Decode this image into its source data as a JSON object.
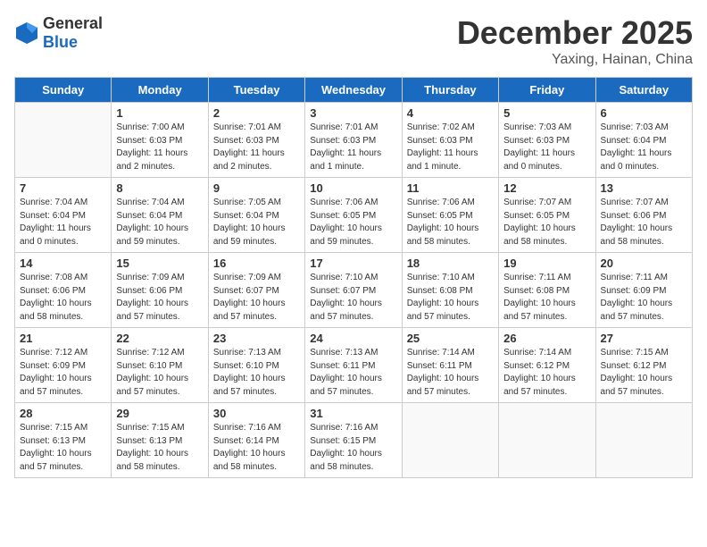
{
  "header": {
    "logo_general": "General",
    "logo_blue": "Blue",
    "month": "December 2025",
    "location": "Yaxing, Hainan, China"
  },
  "days_of_week": [
    "Sunday",
    "Monday",
    "Tuesday",
    "Wednesday",
    "Thursday",
    "Friday",
    "Saturday"
  ],
  "weeks": [
    [
      {
        "num": "",
        "info": ""
      },
      {
        "num": "1",
        "info": "Sunrise: 7:00 AM\nSunset: 6:03 PM\nDaylight: 11 hours\nand 2 minutes."
      },
      {
        "num": "2",
        "info": "Sunrise: 7:01 AM\nSunset: 6:03 PM\nDaylight: 11 hours\nand 2 minutes."
      },
      {
        "num": "3",
        "info": "Sunrise: 7:01 AM\nSunset: 6:03 PM\nDaylight: 11 hours\nand 1 minute."
      },
      {
        "num": "4",
        "info": "Sunrise: 7:02 AM\nSunset: 6:03 PM\nDaylight: 11 hours\nand 1 minute."
      },
      {
        "num": "5",
        "info": "Sunrise: 7:03 AM\nSunset: 6:03 PM\nDaylight: 11 hours\nand 0 minutes."
      },
      {
        "num": "6",
        "info": "Sunrise: 7:03 AM\nSunset: 6:04 PM\nDaylight: 11 hours\nand 0 minutes."
      }
    ],
    [
      {
        "num": "7",
        "info": "Sunrise: 7:04 AM\nSunset: 6:04 PM\nDaylight: 11 hours\nand 0 minutes."
      },
      {
        "num": "8",
        "info": "Sunrise: 7:04 AM\nSunset: 6:04 PM\nDaylight: 10 hours\nand 59 minutes."
      },
      {
        "num": "9",
        "info": "Sunrise: 7:05 AM\nSunset: 6:04 PM\nDaylight: 10 hours\nand 59 minutes."
      },
      {
        "num": "10",
        "info": "Sunrise: 7:06 AM\nSunset: 6:05 PM\nDaylight: 10 hours\nand 59 minutes."
      },
      {
        "num": "11",
        "info": "Sunrise: 7:06 AM\nSunset: 6:05 PM\nDaylight: 10 hours\nand 58 minutes."
      },
      {
        "num": "12",
        "info": "Sunrise: 7:07 AM\nSunset: 6:05 PM\nDaylight: 10 hours\nand 58 minutes."
      },
      {
        "num": "13",
        "info": "Sunrise: 7:07 AM\nSunset: 6:06 PM\nDaylight: 10 hours\nand 58 minutes."
      }
    ],
    [
      {
        "num": "14",
        "info": "Sunrise: 7:08 AM\nSunset: 6:06 PM\nDaylight: 10 hours\nand 58 minutes."
      },
      {
        "num": "15",
        "info": "Sunrise: 7:09 AM\nSunset: 6:06 PM\nDaylight: 10 hours\nand 57 minutes."
      },
      {
        "num": "16",
        "info": "Sunrise: 7:09 AM\nSunset: 6:07 PM\nDaylight: 10 hours\nand 57 minutes."
      },
      {
        "num": "17",
        "info": "Sunrise: 7:10 AM\nSunset: 6:07 PM\nDaylight: 10 hours\nand 57 minutes."
      },
      {
        "num": "18",
        "info": "Sunrise: 7:10 AM\nSunset: 6:08 PM\nDaylight: 10 hours\nand 57 minutes."
      },
      {
        "num": "19",
        "info": "Sunrise: 7:11 AM\nSunset: 6:08 PM\nDaylight: 10 hours\nand 57 minutes."
      },
      {
        "num": "20",
        "info": "Sunrise: 7:11 AM\nSunset: 6:09 PM\nDaylight: 10 hours\nand 57 minutes."
      }
    ],
    [
      {
        "num": "21",
        "info": "Sunrise: 7:12 AM\nSunset: 6:09 PM\nDaylight: 10 hours\nand 57 minutes."
      },
      {
        "num": "22",
        "info": "Sunrise: 7:12 AM\nSunset: 6:10 PM\nDaylight: 10 hours\nand 57 minutes."
      },
      {
        "num": "23",
        "info": "Sunrise: 7:13 AM\nSunset: 6:10 PM\nDaylight: 10 hours\nand 57 minutes."
      },
      {
        "num": "24",
        "info": "Sunrise: 7:13 AM\nSunset: 6:11 PM\nDaylight: 10 hours\nand 57 minutes."
      },
      {
        "num": "25",
        "info": "Sunrise: 7:14 AM\nSunset: 6:11 PM\nDaylight: 10 hours\nand 57 minutes."
      },
      {
        "num": "26",
        "info": "Sunrise: 7:14 AM\nSunset: 6:12 PM\nDaylight: 10 hours\nand 57 minutes."
      },
      {
        "num": "27",
        "info": "Sunrise: 7:15 AM\nSunset: 6:12 PM\nDaylight: 10 hours\nand 57 minutes."
      }
    ],
    [
      {
        "num": "28",
        "info": "Sunrise: 7:15 AM\nSunset: 6:13 PM\nDaylight: 10 hours\nand 57 minutes."
      },
      {
        "num": "29",
        "info": "Sunrise: 7:15 AM\nSunset: 6:13 PM\nDaylight: 10 hours\nand 58 minutes."
      },
      {
        "num": "30",
        "info": "Sunrise: 7:16 AM\nSunset: 6:14 PM\nDaylight: 10 hours\nand 58 minutes."
      },
      {
        "num": "31",
        "info": "Sunrise: 7:16 AM\nSunset: 6:15 PM\nDaylight: 10 hours\nand 58 minutes."
      },
      {
        "num": "",
        "info": ""
      },
      {
        "num": "",
        "info": ""
      },
      {
        "num": "",
        "info": ""
      }
    ]
  ]
}
